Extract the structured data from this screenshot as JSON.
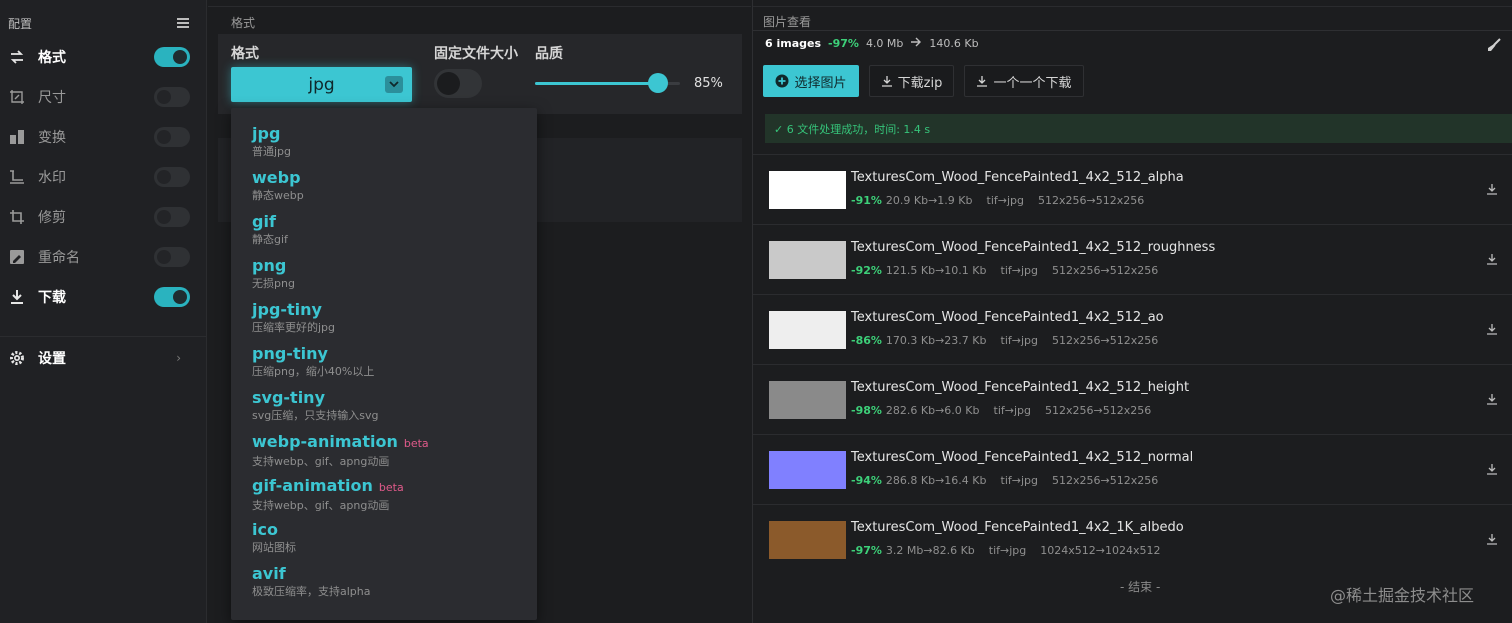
{
  "sidebar": {
    "header": "配置",
    "items": [
      {
        "label": "格式",
        "active": true,
        "toggle": true
      },
      {
        "label": "尺寸",
        "active": false,
        "toggle": false
      },
      {
        "label": "变换",
        "active": false,
        "toggle": false
      },
      {
        "label": "水印",
        "active": false,
        "toggle": false
      },
      {
        "label": "修剪",
        "active": false,
        "toggle": false
      },
      {
        "label": "重命名",
        "active": false,
        "toggle": false
      },
      {
        "label": "下载",
        "active": true,
        "toggle": true
      }
    ],
    "settings_label": "设置",
    "settings_chevron": "›"
  },
  "middle": {
    "section_label": "格式",
    "format_label": "格式",
    "fixed_size_label": "固定文件大小",
    "quality_label": "品质",
    "selected_format": "jpg",
    "quality_value_text": "85%",
    "quality_fraction": 0.85
  },
  "dropdown": {
    "options": [
      {
        "name": "jpg",
        "desc": "普通jpg",
        "beta": ""
      },
      {
        "name": "webp",
        "desc": "静态webp",
        "beta": ""
      },
      {
        "name": "gif",
        "desc": "静态gif",
        "beta": ""
      },
      {
        "name": "png",
        "desc": "无损png",
        "beta": ""
      },
      {
        "name": "jpg-tiny",
        "desc": "压缩率更好的jpg",
        "beta": ""
      },
      {
        "name": "png-tiny",
        "desc": "压缩png，缩小40%以上",
        "beta": ""
      },
      {
        "name": "svg-tiny",
        "desc": "svg压缩，只支持输入svg",
        "beta": ""
      },
      {
        "name": "webp-animation",
        "desc": "支持webp、gif、apng动画",
        "beta": "beta"
      },
      {
        "name": "gif-animation",
        "desc": "支持webp、gif、apng动画",
        "beta": "beta"
      },
      {
        "name": "ico",
        "desc": "网站图标",
        "beta": ""
      },
      {
        "name": "avif",
        "desc": "极致压缩率，支持alpha",
        "beta": ""
      }
    ]
  },
  "viewer": {
    "section_label": "图片查看",
    "image_count": "6 images",
    "total_pct": "-97%",
    "size_before": "4.0 Mb",
    "size_after": "140.6 Kb",
    "buttons": {
      "select": "选择图片",
      "zip": "下载zip",
      "one_by_one": "一个一个下载"
    },
    "success_text": "✓ 6 文件处理成功，时间:   1.4 s",
    "files": [
      {
        "name": "TexturesCom_Wood_FencePainted1_4x2_512_alpha",
        "pct": "-91%",
        "sizes": "20.9 Kb→1.9 Kb",
        "convert": "tif→jpg",
        "dims": "512x256→512x256",
        "thumb_color": "#ffffff"
      },
      {
        "name": "TexturesCom_Wood_FencePainted1_4x2_512_roughness",
        "pct": "-92%",
        "sizes": "121.5 Kb→10.1 Kb",
        "convert": "tif→jpg",
        "dims": "512x256→512x256",
        "thumb_color": "#c9c9c9"
      },
      {
        "name": "TexturesCom_Wood_FencePainted1_4x2_512_ao",
        "pct": "-86%",
        "sizes": "170.3 Kb→23.7 Kb",
        "convert": "tif→jpg",
        "dims": "512x256→512x256",
        "thumb_color": "#eeeeee"
      },
      {
        "name": "TexturesCom_Wood_FencePainted1_4x2_512_height",
        "pct": "-98%",
        "sizes": "282.6 Kb→6.0 Kb",
        "convert": "tif→jpg",
        "dims": "512x256→512x256",
        "thumb_color": "#8a8a8a"
      },
      {
        "name": "TexturesCom_Wood_FencePainted1_4x2_512_normal",
        "pct": "-94%",
        "sizes": "286.8 Kb→16.4 Kb",
        "convert": "tif→jpg",
        "dims": "512x256→512x256",
        "thumb_color": "#8080ff"
      },
      {
        "name": "TexturesCom_Wood_FencePainted1_4x2_1K_albedo",
        "pct": "-97%",
        "sizes": "3.2 Mb→82.6 Kb",
        "convert": "tif→jpg",
        "dims": "1024x512→1024x512",
        "thumb_color": "#8b5a2b"
      }
    ],
    "end_text": "- 结束 -"
  },
  "watermark": "@稀土掘金技术社区",
  "colors": {
    "accent": "#3cc6d2",
    "success": "#3dd079",
    "beta": "#e05a8a"
  }
}
